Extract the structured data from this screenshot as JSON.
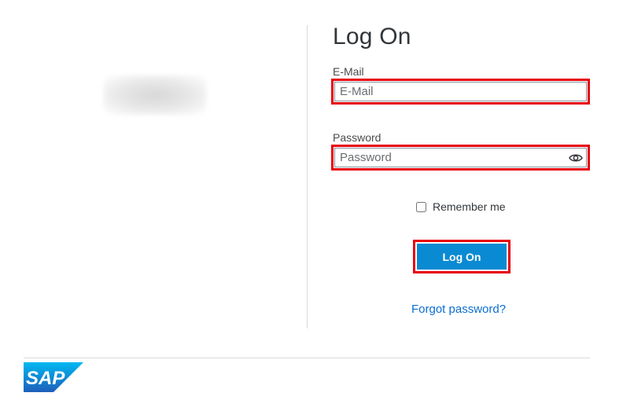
{
  "form": {
    "title": "Log On",
    "email": {
      "label": "E-Mail",
      "value": "",
      "placeholder": "E-Mail"
    },
    "password": {
      "label": "Password",
      "value": "",
      "placeholder": "Password"
    },
    "remember_label": "Remember me",
    "logon_button": "Log On",
    "forgot_link": "Forgot password?"
  },
  "footer": {
    "logo_text": "SAP"
  },
  "icons": {
    "show_password": "eye-icon"
  },
  "colors": {
    "accent": "#0a8ad2",
    "link": "#0a6ed1",
    "highlight": "#e8000b",
    "sap_blue": "#0a8ad2"
  }
}
